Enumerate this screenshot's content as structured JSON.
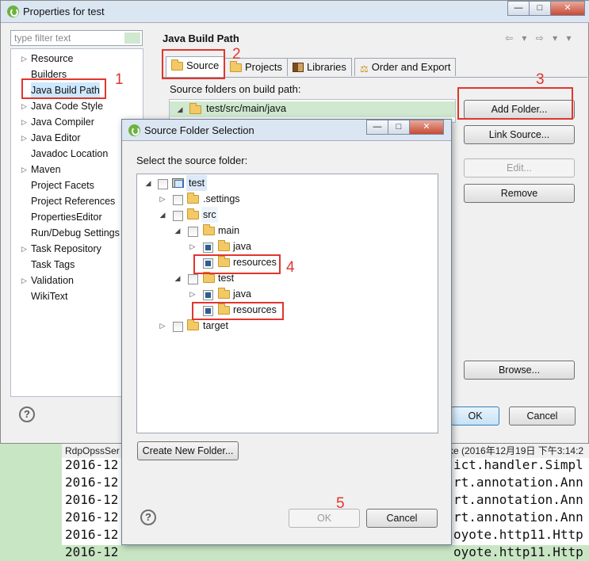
{
  "window": {
    "title": "Properties for test",
    "filter_placeholder": "type filter text",
    "nav_items": [
      "Resource",
      "Builders",
      "Java Build Path",
      "Java Code Style",
      "Java Compiler",
      "Java Editor",
      "Javadoc Location",
      "Maven",
      "Project Facets",
      "Project References",
      "PropertiesEditor",
      "Run/Debug Settings",
      "Task Repository",
      "Task Tags",
      "Validation",
      "WikiText"
    ],
    "selected_nav": "Java Build Path",
    "section_title": "Java Build Path",
    "tabs": [
      "Source",
      "Projects",
      "Libraries",
      "Order and Export"
    ],
    "active_tab": "Source",
    "source_label": "Source folders on build path:",
    "source_entries": [
      "test/src/main/java"
    ],
    "buttons": {
      "add_folder": "Add Folder...",
      "link_source": "Link Source...",
      "edit": "Edit...",
      "remove": "Remove",
      "browse": "Browse...",
      "ok": "OK",
      "cancel": "Cancel"
    }
  },
  "console": {
    "header_left": "RdpOpssSer",
    "header_right": "ke (2016年12月19日 下午3:14:2",
    "lines": [
      {
        "left": "2016-12",
        "right": "ict.handler.Simpl"
      },
      {
        "left": "2016-12",
        "right": "rt.annotation.Ann"
      },
      {
        "left": "2016-12",
        "right": "rt.annotation.Ann"
      },
      {
        "left": "2016-12",
        "right": "rt.annotation.Ann"
      },
      {
        "left": "2016-12",
        "right": "oyote.http11.Http"
      },
      {
        "left": "2016-12",
        "right": "oyote.http11.Http"
      }
    ]
  },
  "dialog": {
    "title": "Source Folder Selection",
    "label": "Select the source folder:",
    "tree": {
      "test": "test",
      "settings": ".settings",
      "src": "src",
      "main": "main",
      "main_java": "java",
      "main_resources": "resources",
      "test_dir": "test",
      "test_java": "java",
      "test_resources": "resources",
      "target": "target"
    },
    "create_folder": "Create New Folder...",
    "ok": "OK",
    "cancel": "Cancel"
  },
  "annotations": [
    "1",
    "2",
    "3",
    "4",
    "4",
    "5"
  ],
  "colors": {
    "annotation_red": "#e0362e",
    "selection_green": "#cfe8cf",
    "title_bar": "#dbe6f3"
  }
}
